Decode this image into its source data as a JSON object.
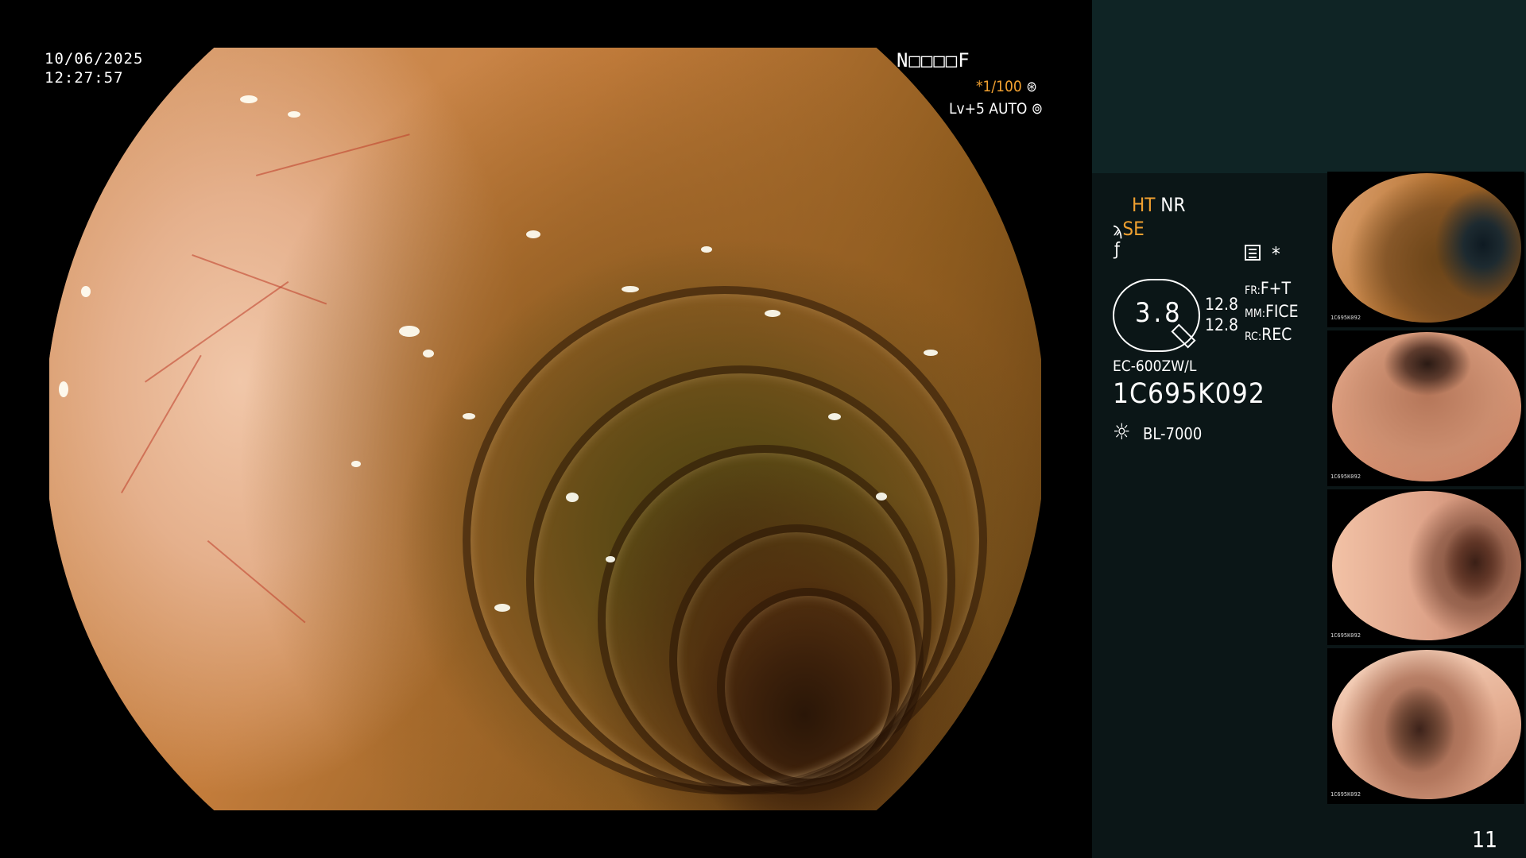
{
  "overlay": {
    "date": "10/06/2025",
    "time": "12:27:57",
    "patient_id": "N□□□□F",
    "shutter": "*1/100",
    "iris": "Lv+5 AUTO"
  },
  "info_panel": {
    "ht": "HT",
    "nr": "NR",
    "se": "SE",
    "f_symbol": "ƒ",
    "star": "*",
    "hex_value": "3.8",
    "values": [
      "12.8",
      "12.8"
    ],
    "fr_label": "FR:",
    "fr_value": "F+T",
    "mm_label": "MM:",
    "mm_value": "FICE",
    "rc_label": "RC:",
    "rc_value": "REC",
    "scope_model": "EC-600ZW/L",
    "scope_serial": "1C695K092",
    "light_source": "BL-7000"
  },
  "page_number": "11",
  "thumbnails": [
    {
      "tag": "1C695K092"
    },
    {
      "tag": "1C695K092"
    },
    {
      "tag": "1C695K092"
    },
    {
      "tag": "1C695K092"
    }
  ],
  "colors": {
    "accent": "#f0a030",
    "panel_bg": "#0b1617",
    "panel_top": "#0f2425"
  }
}
